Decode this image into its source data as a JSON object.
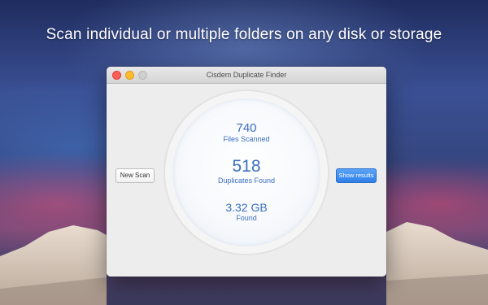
{
  "headline": "Scan individual or multiple folders on any disk or storage",
  "window": {
    "title": "Cisdem Duplicate Finder"
  },
  "stats": {
    "files_scanned": {
      "value": "740",
      "label": "Files Scanned"
    },
    "duplicates_found": {
      "value": "518",
      "label": "Duplicates Found"
    },
    "size_found": {
      "value": "3.32 GB",
      "label": "Found"
    }
  },
  "buttons": {
    "new_scan": "New Scan",
    "show_results": "Show results"
  },
  "colors": {
    "accent": "#3a6fc0",
    "primary_button": "#2f7fe8",
    "close": "#fc5f57",
    "minimize": "#fdbc2e"
  },
  "icons": {
    "close": "close-dot-icon",
    "minimize": "minimize-dot-icon",
    "zoom": "zoom-dot-icon"
  }
}
